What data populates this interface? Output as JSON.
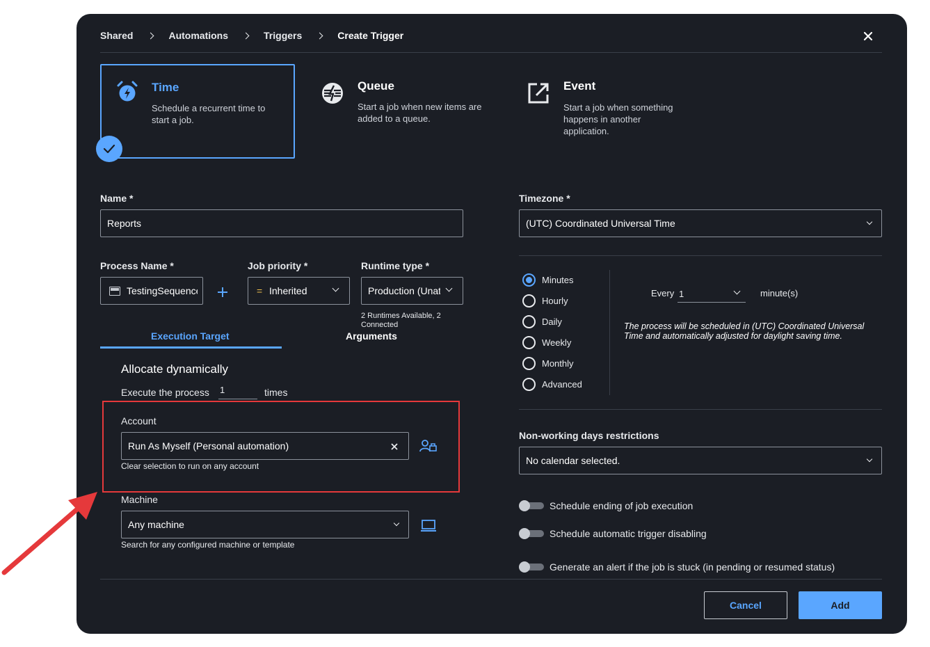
{
  "breadcrumb": {
    "items": [
      "Shared",
      "Automations",
      "Triggers"
    ],
    "current": "Create Trigger"
  },
  "trigger_types": [
    {
      "title": "Time",
      "desc_lines": [
        "Schedule a recurrent time to",
        "start a job."
      ],
      "icon": "alarm-clock-icon",
      "selected": true
    },
    {
      "title": "Queue",
      "desc_lines": [
        "Start a job when new items are",
        "added to a queue."
      ],
      "icon": "queue-icon",
      "selected": false
    },
    {
      "title": "Event",
      "desc_lines": [
        "Start a job when something",
        "happens in another",
        "application."
      ],
      "icon": "external-link-icon",
      "selected": false
    }
  ],
  "name": {
    "label": "Name *",
    "value": "Reports"
  },
  "timezone": {
    "label": "Timezone *",
    "value": "(UTC) Coordinated Universal Time"
  },
  "process_name": {
    "label": "Process Name *",
    "value": "TestingSequence"
  },
  "job_priority": {
    "label": "Job priority *",
    "prefix": "=",
    "value": "Inherited"
  },
  "runtime_type": {
    "label": "Runtime type *",
    "value": "Production (Unattended)",
    "hint_lines": [
      "2 Runtimes Available, 2",
      "Connected"
    ]
  },
  "tabs": {
    "execution_target": "Execution Target",
    "arguments": "Arguments"
  },
  "allocate": {
    "title": "Allocate dynamically",
    "execute_prefix": "Execute the process",
    "execute_value": "1",
    "execute_suffix": "times"
  },
  "account": {
    "label": "Account",
    "value": "Run As Myself (Personal automation)",
    "hint": "Clear selection to run on any account"
  },
  "machine": {
    "label": "Machine",
    "value": "Any machine",
    "hint": "Search for any configured machine or template"
  },
  "frequency": {
    "options": [
      "Minutes",
      "Hourly",
      "Daily",
      "Weekly",
      "Monthly",
      "Advanced"
    ],
    "selected": "Minutes",
    "every_label": "Every",
    "every_value": "1",
    "unit": "minute(s)",
    "note_lines": [
      "The process will be scheduled in (UTC) Coordinated Universal",
      "Time and automatically adjusted for daylight saving time."
    ]
  },
  "non_working": {
    "label": "Non-working days restrictions",
    "value": "No calendar selected."
  },
  "toggles": [
    "Schedule ending of job execution",
    "Schedule automatic trigger disabling",
    "Generate an alert if the job is stuck (in pending or resumed status)"
  ],
  "buttons": {
    "cancel": "Cancel",
    "add": "Add"
  },
  "colors": {
    "accent": "#5aa6ff",
    "highlight": "#e5393b",
    "background": "#1b1e25"
  }
}
